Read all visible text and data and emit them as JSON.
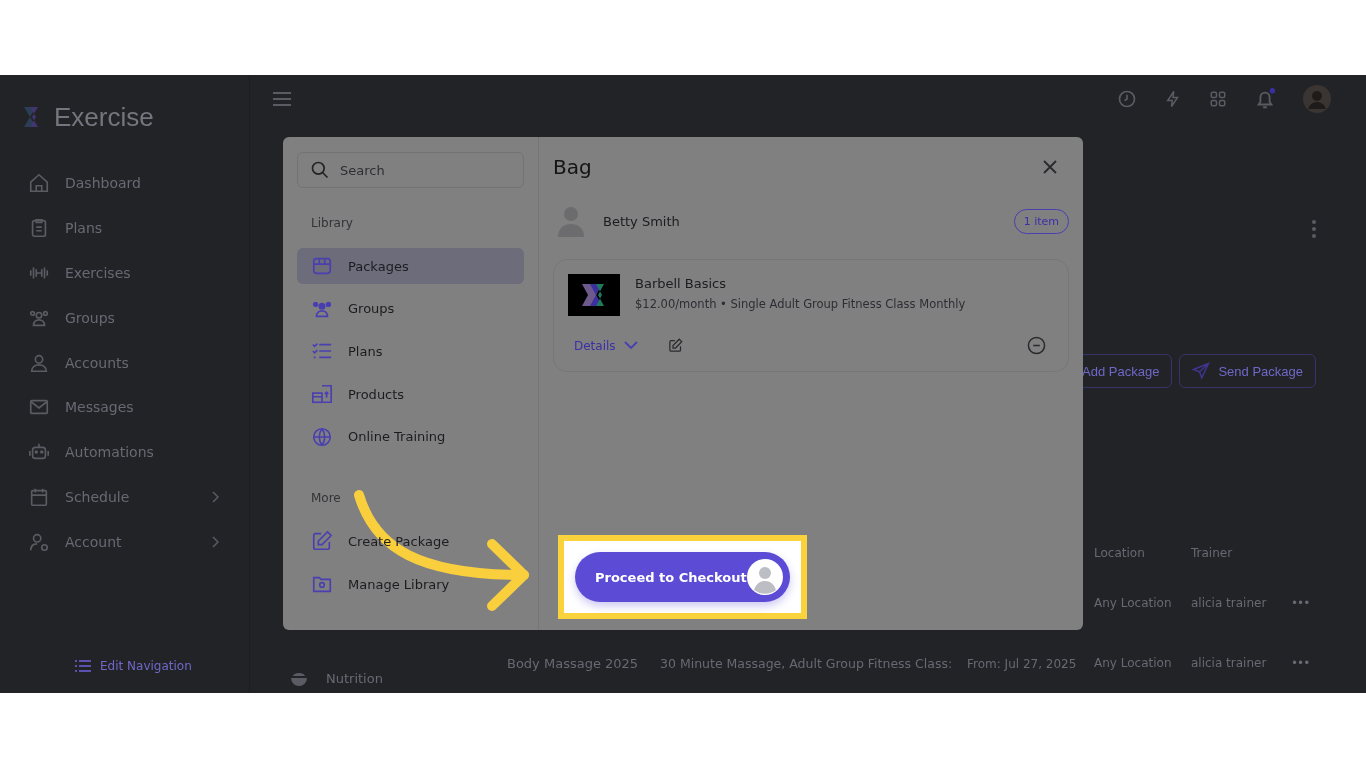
{
  "brand": {
    "name": "Exercise"
  },
  "sidebar": {
    "items": [
      {
        "label": "Dashboard",
        "has_submenu": false
      },
      {
        "label": "Plans",
        "has_submenu": false
      },
      {
        "label": "Exercises",
        "has_submenu": false
      },
      {
        "label": "Groups",
        "has_submenu": false
      },
      {
        "label": "Accounts",
        "has_submenu": false
      },
      {
        "label": "Messages",
        "has_submenu": false
      },
      {
        "label": "Automations",
        "has_submenu": false
      },
      {
        "label": "Schedule",
        "has_submenu": true
      },
      {
        "label": "Account",
        "has_submenu": true
      }
    ],
    "footer": "Edit Navigation"
  },
  "topbar": {
    "notification_unread": true
  },
  "page": {
    "buttons": [
      "Add Package",
      "Send Package"
    ],
    "sub_nav": "Nutrition",
    "table": {
      "columns": [
        "Location",
        "Trainer"
      ],
      "rows": [
        {
          "location": "Any Location",
          "trainer": "alicia trainer",
          "menu": "•••"
        },
        {
          "name": "Body Massage 2025",
          "description": "30 Minute Massage, Adult Group Fitness Class:",
          "dates": "From: Jul 27, 2025",
          "location": "Any Location",
          "trainer": "alicia trainer",
          "menu": "•••"
        }
      ]
    }
  },
  "modal": {
    "search": {
      "placeholder": "Search"
    },
    "sections": [
      {
        "title": "Library",
        "items": [
          {
            "label": "Packages",
            "selected": true
          },
          {
            "label": "Groups",
            "selected": false
          },
          {
            "label": "Plans",
            "selected": false
          },
          {
            "label": "Products",
            "selected": false
          },
          {
            "label": "Online Training",
            "selected": false
          }
        ]
      },
      {
        "title": "More",
        "items": [
          {
            "label": "Create Package",
            "selected": false
          },
          {
            "label": "Manage Library",
            "selected": false
          }
        ]
      }
    ],
    "bag": {
      "title": "Bag",
      "customer": "Betty Smith",
      "count": "1 item",
      "items": [
        {
          "name": "Barbell Basics",
          "detail": "$12.00/month • Single Adult Group Fitness Class Monthly",
          "details_label": "Details"
        }
      ],
      "checkout": "Proceed to Checkout"
    }
  }
}
